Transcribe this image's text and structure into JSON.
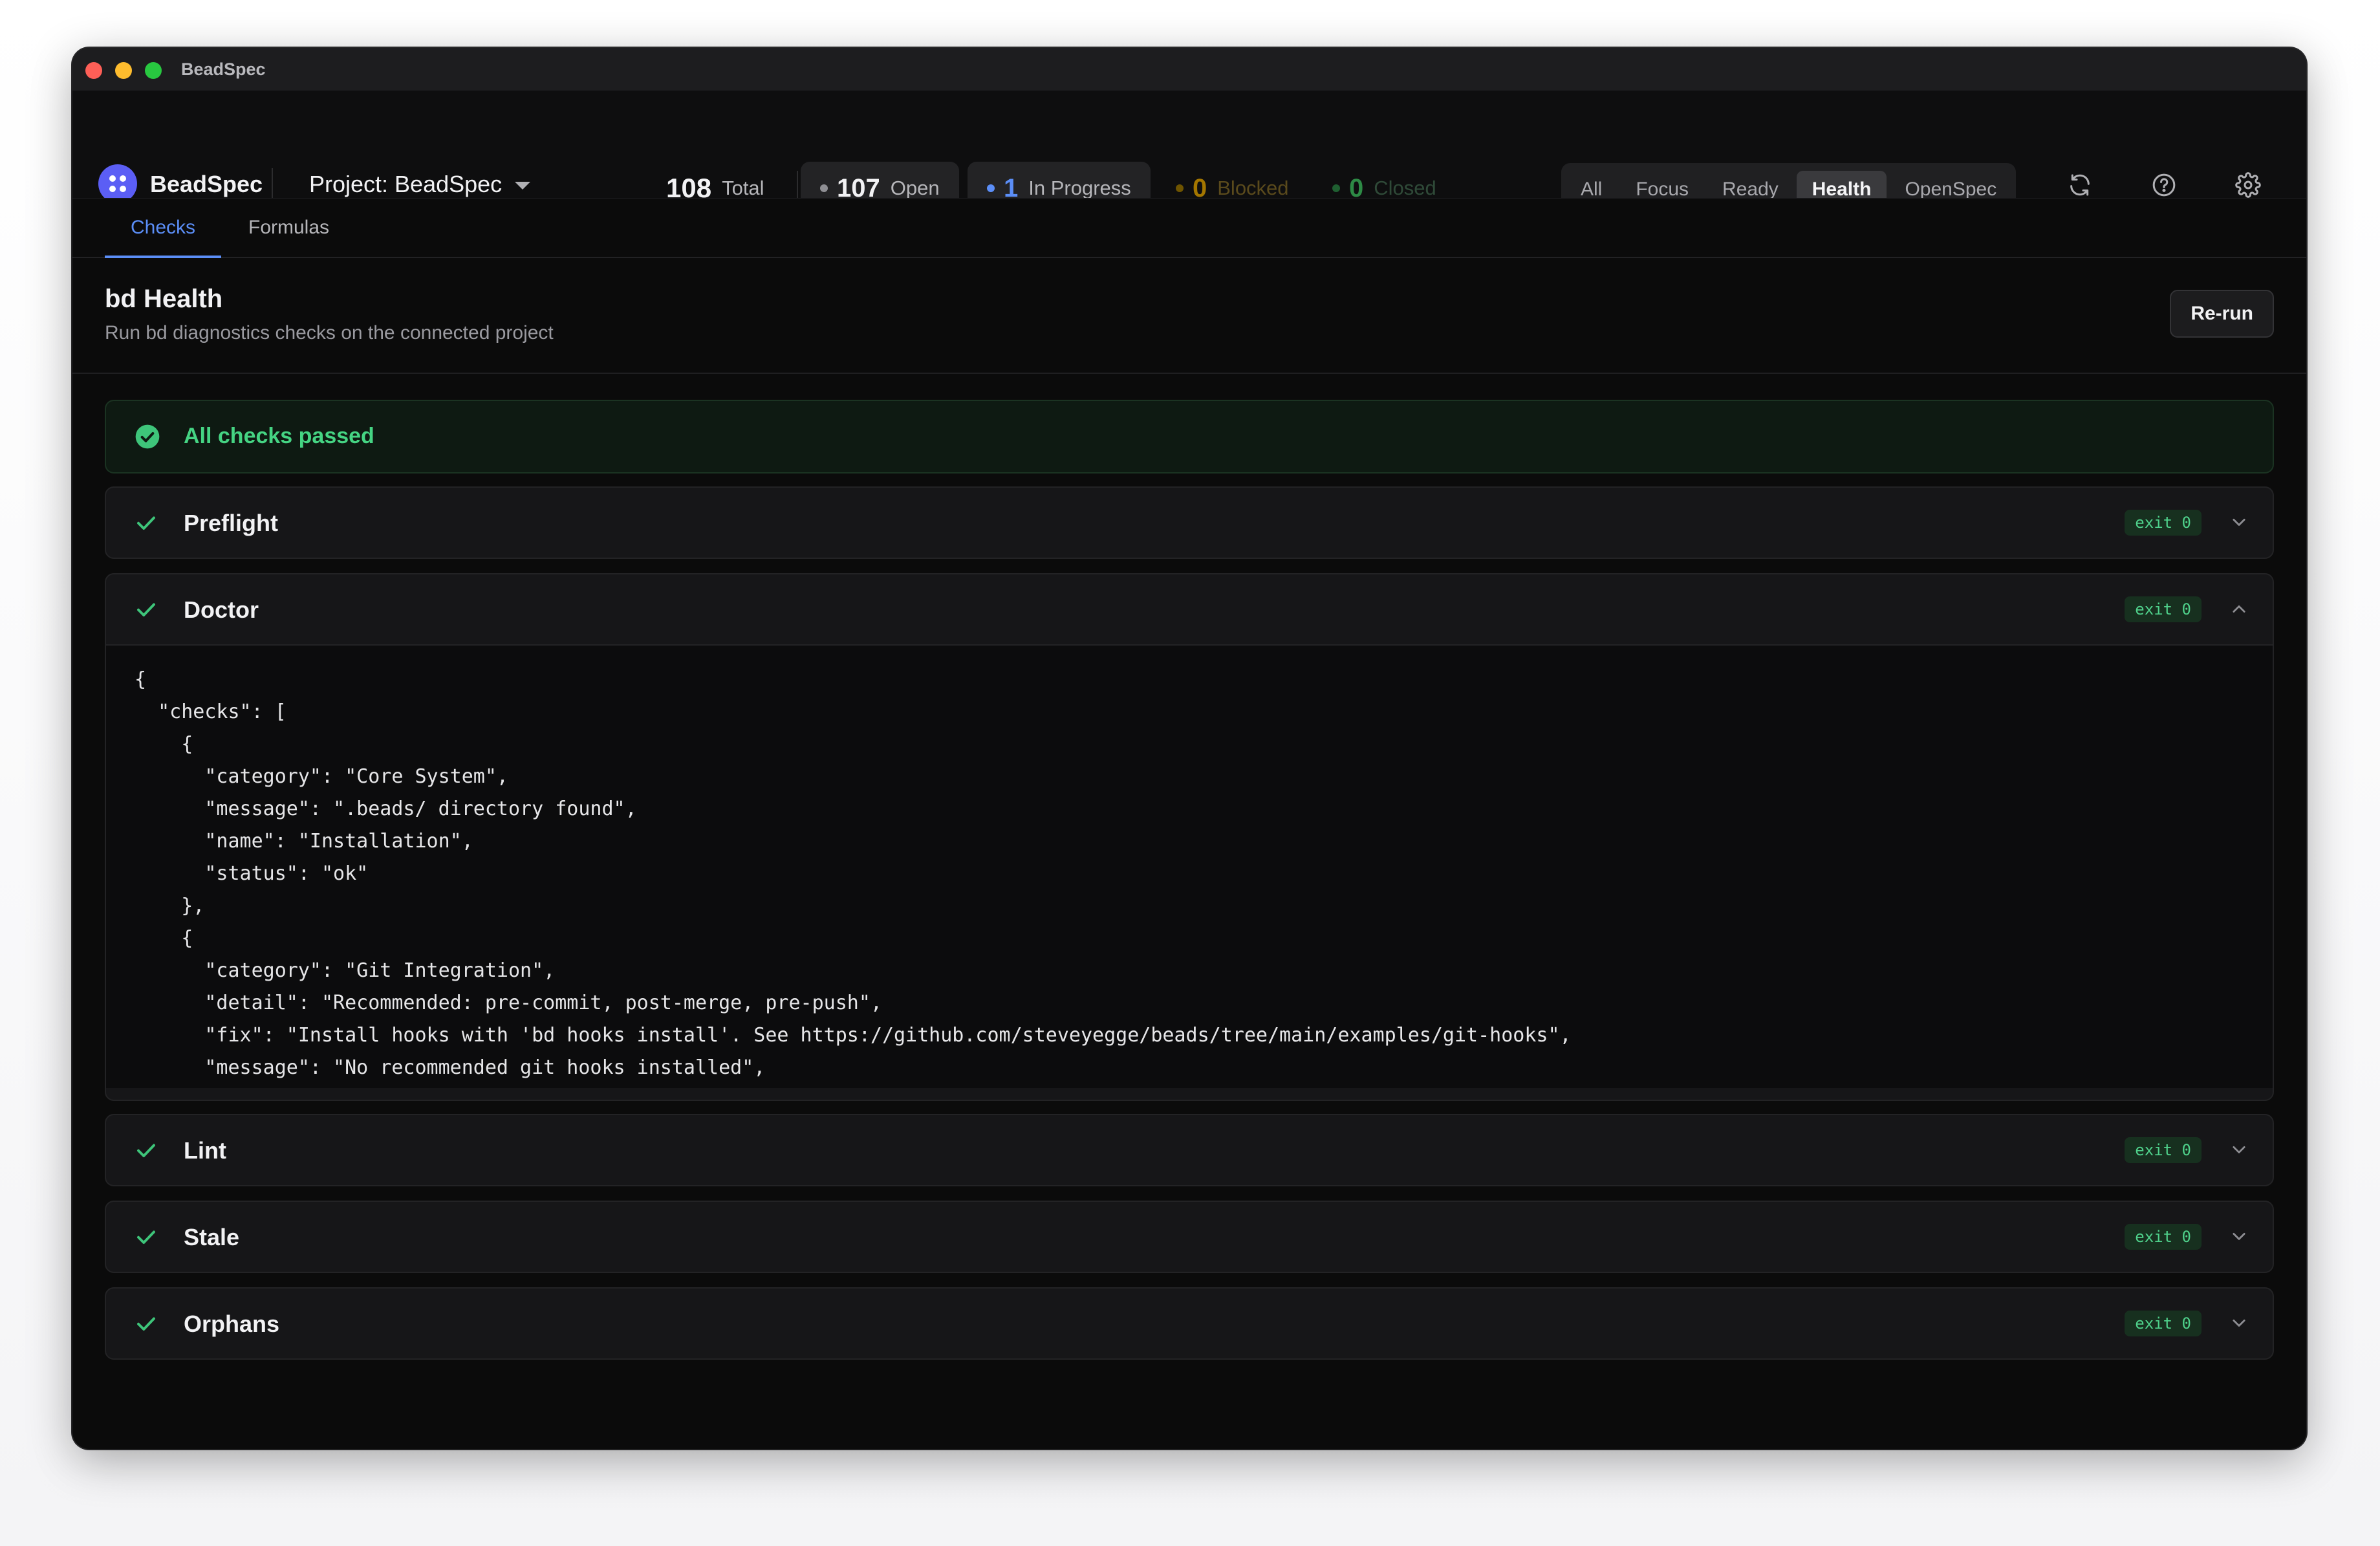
{
  "window": {
    "title": "BeadSpec"
  },
  "brand": {
    "name": "BeadSpec"
  },
  "project": {
    "label": "Project: BeadSpec"
  },
  "stats": {
    "total": {
      "value": "108",
      "label": "Total"
    },
    "open": {
      "value": "107",
      "label": "Open"
    },
    "in_progress": {
      "value": "1",
      "label": "In Progress"
    },
    "blocked": {
      "value": "0",
      "label": "Blocked"
    },
    "closed": {
      "value": "0",
      "label": "Closed"
    }
  },
  "view_tabs": [
    {
      "label": "All",
      "active": false
    },
    {
      "label": "Focus",
      "active": false
    },
    {
      "label": "Ready",
      "active": false
    },
    {
      "label": "Health",
      "active": true
    },
    {
      "label": "OpenSpec",
      "active": false
    }
  ],
  "toolbar_icons": [
    "refresh-icon",
    "help-icon",
    "settings-icon"
  ],
  "subtabs": [
    {
      "label": "Checks",
      "active": true
    },
    {
      "label": "Formulas",
      "active": false
    }
  ],
  "header": {
    "title": "bd Health",
    "subtitle": "Run bd diagnostics checks on the connected project",
    "rerun_label": "Re-run"
  },
  "banner": {
    "text": "All checks passed",
    "icon": "check-circle-icon"
  },
  "sections": [
    {
      "name": "Preflight",
      "exit": "exit 0",
      "expanded": false
    },
    {
      "name": "Doctor",
      "exit": "exit 0",
      "expanded": true
    },
    {
      "name": "Lint",
      "exit": "exit 0",
      "expanded": false
    },
    {
      "name": "Stale",
      "exit": "exit 0",
      "expanded": false
    },
    {
      "name": "Orphans",
      "exit": "exit 0",
      "expanded": false
    }
  ],
  "doctor_output": "{\n  \"checks\": [\n    {\n      \"category\": \"Core System\",\n      \"message\": \".beads/ directory found\",\n      \"name\": \"Installation\",\n      \"status\": \"ok\"\n    },\n    {\n      \"category\": \"Git Integration\",\n      \"detail\": \"Recommended: pre-commit, post-merge, pre-push\",\n      \"fix\": \"Install hooks with 'bd hooks install'. See https://github.com/steveyegge/beads/tree/main/examples/git-hooks\",\n      \"message\": \"No recommended git hooks installed\",",
  "colors": {
    "accent": "#5b8ef7",
    "success": "#45d483",
    "brand": "#5b5ef5",
    "background": "#0b0b0b"
  }
}
